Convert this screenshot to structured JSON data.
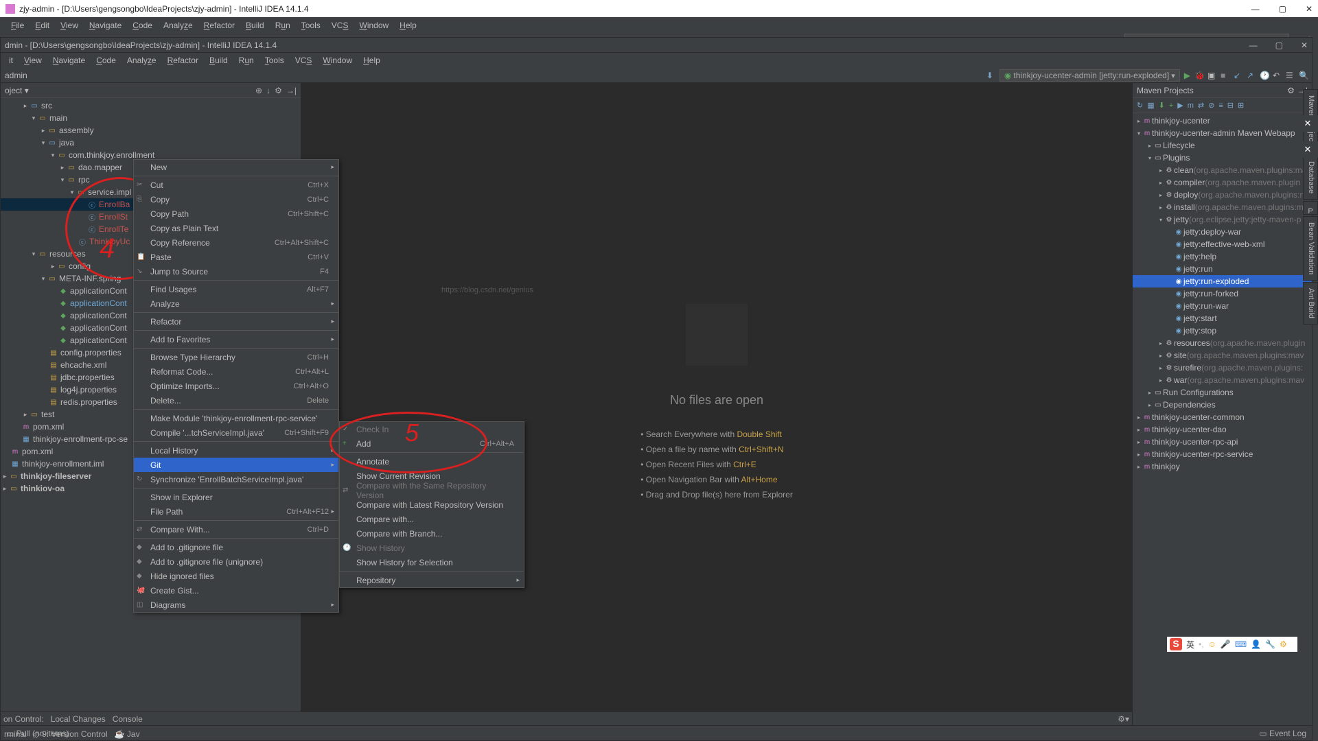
{
  "outer_title": "zjy-admin - [D:\\Users\\gengsongbo\\IdeaProjects\\zjy-admin] - IntelliJ IDEA 14.1.4",
  "inner_title": "dmin - [D:\\Users\\gengsongbo\\IdeaProjects\\zjy-admin] - IntelliJ IDEA 14.1.4",
  "menus": [
    "File",
    "Edit",
    "View",
    "Navigate",
    "Code",
    "Analyze",
    "Refactor",
    "Build",
    "Run",
    "Tools",
    "VCS",
    "Window",
    "Help"
  ],
  "inner_menus": [
    "it",
    "View",
    "Navigate",
    "Code",
    "Analyze",
    "Refactor",
    "Build",
    "Run",
    "Tools",
    "VCS",
    "Window",
    "Help"
  ],
  "breadcrumb": "admin",
  "proj_selector": "oject",
  "run_cfg_outer": "thinkjoy-ucenter-admin [jetty:run-exploded]",
  "run_cfg_inner": "thinkjoy-ucenter-admin [jetty:run-exploded]",
  "tree": {
    "src": "src",
    "main": "main",
    "assembly": "assembly",
    "java": "java",
    "pkg": "com.thinkjoy.enrollment",
    "dao": "dao.mapper",
    "rpc": "rpc",
    "service": "service.impl",
    "c1": "EnrollBa",
    "c2": "EnrollSt",
    "c3": "EnrollTe",
    "c4": "ThinkjoyUc",
    "resources": "resources",
    "config": "config",
    "metainf": "META-INF.spring",
    "a1": "applicationCont",
    "a2": "applicationCont",
    "a3": "applicationCont",
    "a4": "applicationCont",
    "a5": "applicationCont",
    "cp": "config.properties",
    "eh": "ehcache.xml",
    "jd": "jdbc.properties",
    "l4": "log4j.properties",
    "rd": "redis.properties",
    "test": "test",
    "pom": "pom.xml",
    "iml": "thinkjoy-enrollment-rpc-se",
    "pom2": "pom.xml",
    "iml2": "thinkjoy-enrollment.iml",
    "fs": "thinkjoy-fileserver",
    "oa": "thinkiov-oa"
  },
  "editor": {
    "nofiles": "No files are open",
    "h1a": "Search Everywhere with ",
    "h1b": "Double Shift",
    "h2a": "Open a file by name with ",
    "h2b": "Ctrl+Shift+N",
    "h3a": "Open Recent Files with ",
    "h3b": "Ctrl+E",
    "h4a": "Open Navigation Bar with ",
    "h4b": "Alt+Home",
    "h5": "Drag and Drop file(s) here from Explorer",
    "wm": "https://blog.csdn.net/genius"
  },
  "maven": {
    "title": "Maven Projects",
    "n1": "thinkjoy-ucenter",
    "n2": "thinkjoy-ucenter-admin Maven Webapp",
    "lc": "Lifecycle",
    "pl": "Plugins",
    "clean": "clean",
    "clean_d": "(org.apache.maven.plugins:ma",
    "compiler": "compiler",
    "compiler_d": "(org.apache.maven.plugin",
    "deploy": "deploy",
    "deploy_d": "(org.apache.maven.plugins:m",
    "install": "install",
    "install_d": "(org.apache.maven.plugins:m",
    "jetty": "jetty",
    "jetty_d": "(org.eclipse.jetty:jetty-maven-p",
    "j1": "jetty:deploy-war",
    "j2": "jetty:effective-web-xml",
    "j3": "jetty:help",
    "j4": "jetty:run",
    "j5": "jetty:run-exploded",
    "j6": "jetty:run-forked",
    "j7": "jetty:run-war",
    "j8": "jetty:start",
    "j9": "jetty:stop",
    "res": "resources",
    "res_d": "(org.apache.maven.plugin",
    "site": "site",
    "site_d": "(org.apache.maven.plugins:mav",
    "sf": "surefire",
    "sf_d": "(org.apache.maven.plugins:",
    "war": "war",
    "war_d": "(org.apache.maven.plugins:mav",
    "rc": "Run Configurations",
    "dep": "Dependencies",
    "m3": "thinkjoy-ucenter-common",
    "m4": "thinkjoy-ucenter-dao",
    "m5": "thinkjoy-ucenter-rpc-api",
    "m6": "thinkjoy-ucenter-rpc-service",
    "m7": "thinkjoy"
  },
  "ctx1": {
    "new": "New",
    "cut": "Cut",
    "cut_s": "Ctrl+X",
    "copy": "Copy",
    "copy_s": "Ctrl+C",
    "cpath": "Copy Path",
    "cpath_s": "Ctrl+Shift+C",
    "cplain": "Copy as Plain Text",
    "cref": "Copy Reference",
    "cref_s": "Ctrl+Alt+Shift+C",
    "paste": "Paste",
    "paste_s": "Ctrl+V",
    "jump": "Jump to Source",
    "jump_s": "F4",
    "find": "Find Usages",
    "find_s": "Alt+F7",
    "analyze": "Analyze",
    "refactor": "Refactor",
    "fav": "Add to Favorites",
    "bth": "Browse Type Hierarchy",
    "bth_s": "Ctrl+H",
    "ref": "Reformat Code...",
    "ref_s": "Ctrl+Alt+L",
    "opt": "Optimize Imports...",
    "opt_s": "Ctrl+Alt+O",
    "del": "Delete...",
    "del_s": "Delete",
    "mkm": "Make Module 'thinkjoy-enrollment-rpc-service'",
    "cmp": "Compile '...tchServiceImpl.java'",
    "cmp_s": "Ctrl+Shift+F9",
    "lh": "Local History",
    "git": "Git",
    "sync": "Synchronize 'EnrollBatchServiceImpl.java'",
    "sie": "Show in Explorer",
    "fp": "File Path",
    "fp_s": "Ctrl+Alt+F12",
    "cw": "Compare With...",
    "cw_s": "Ctrl+D",
    "agi": "Add to .gitignore file",
    "agu": "Add to .gitignore file (unignore)",
    "hif": "Hide ignored files",
    "cg": "Create Gist...",
    "dg": "Diagrams"
  },
  "ctx2": {
    "checkin": "Check In",
    "add": "Add",
    "add_s": "Ctrl+Alt+A",
    "annotate": "Annotate",
    "scr": "Show Current Revision",
    "csrv": "Compare with the Same Repository Version",
    "clrv": "Compare with Latest Repository Version",
    "cwith": "Compare with...",
    "cwb": "Compare with Branch...",
    "sh": "Show History",
    "shs": "Show History for Selection",
    "repo": "Repository"
  },
  "bottom_tabs": {
    "on": "on Control:",
    "lc": "Local Changes",
    "cons": "Console",
    "term": "rminal",
    "vc": "9: Version Control",
    "jav": "Jav"
  },
  "status": {
    "pull": "Pull (no items)",
    "el": "Event Log"
  },
  "right_tabs": {
    "mp": "Maven Projects",
    "db": "Database",
    "bv": "Bean Validation",
    "ab": "Ant Build",
    "p": "P"
  }
}
